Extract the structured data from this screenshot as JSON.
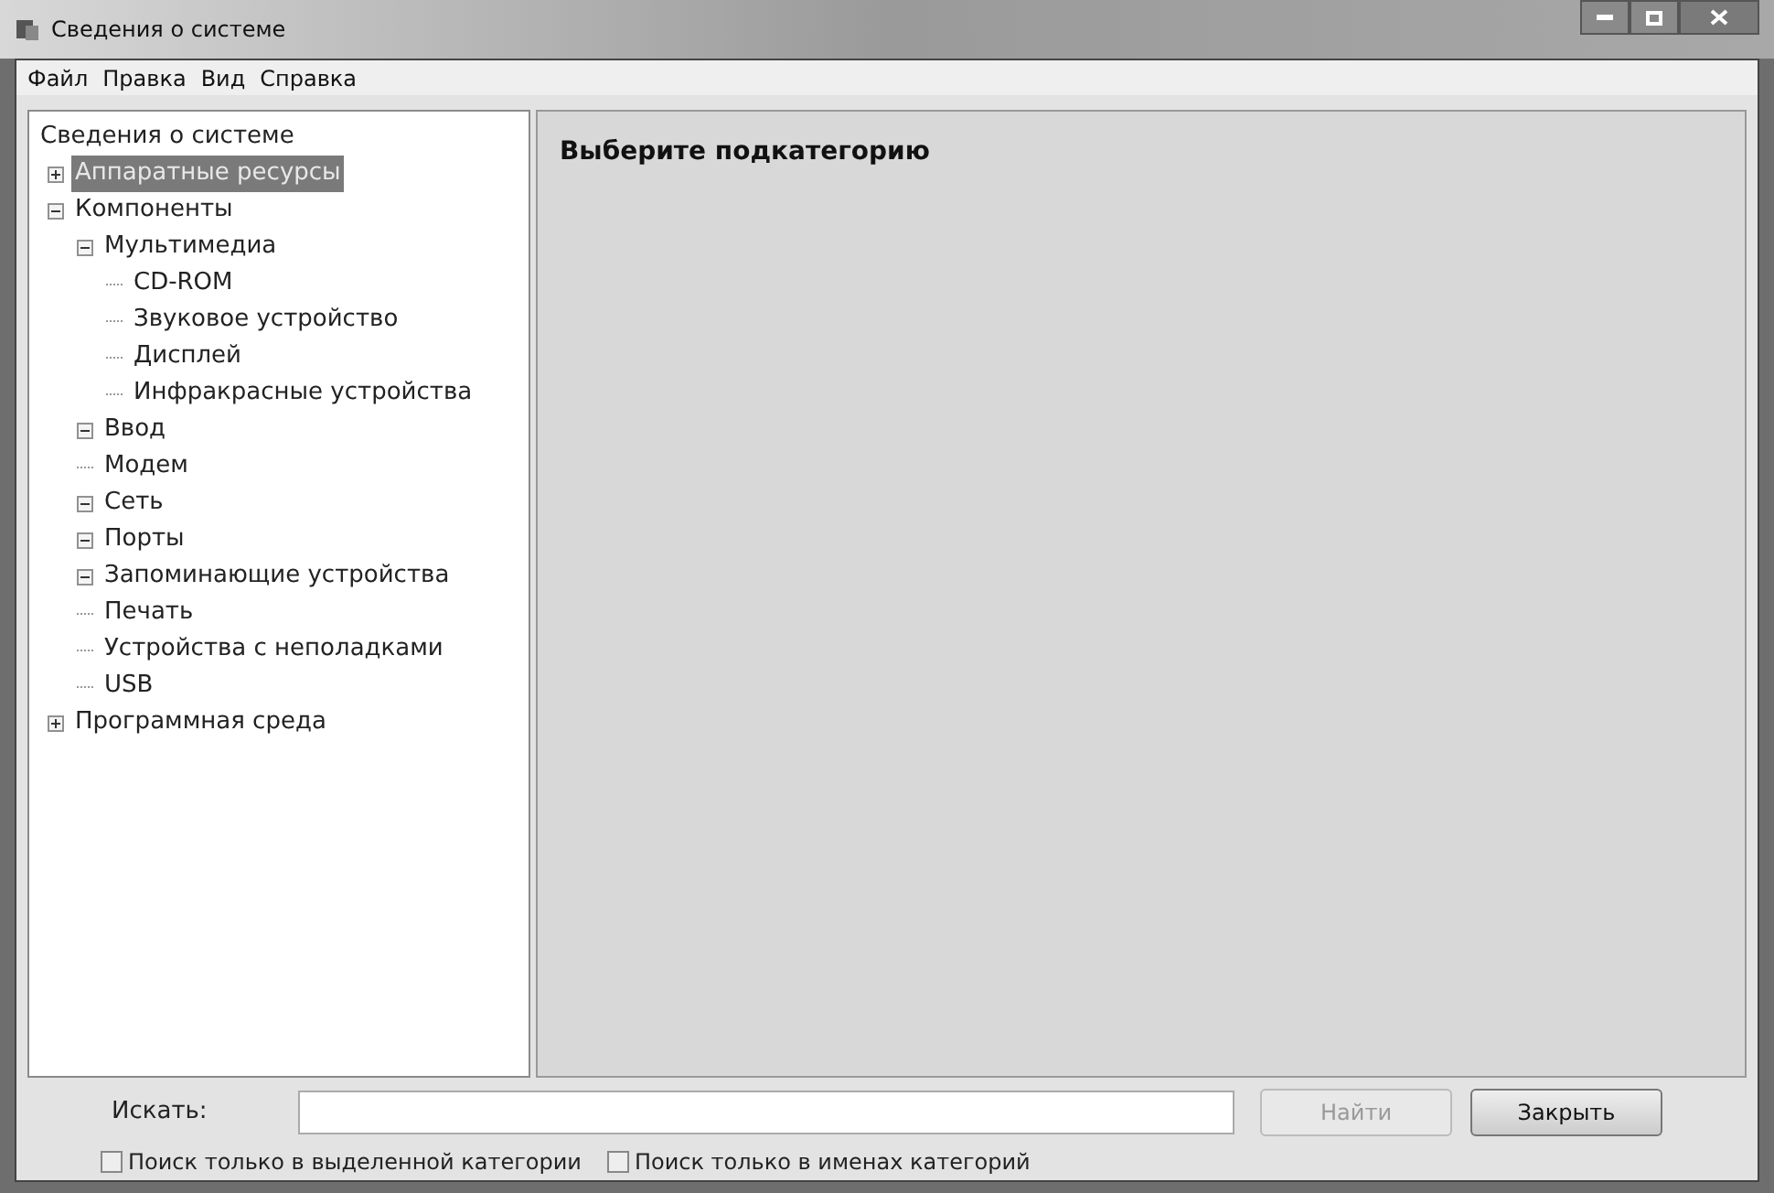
{
  "window": {
    "title": "Сведения о системе"
  },
  "menu": [
    "Файл",
    "Правка",
    "Вид",
    "Справка"
  ],
  "tree": {
    "label": "Сведения о системе",
    "selected": false,
    "children": [
      {
        "label": "Аппаратные ресурсы",
        "selected": true,
        "expanded": false
      },
      {
        "label": "Компоненты",
        "selected": false,
        "expanded": true,
        "children": [
          {
            "label": "Мультимедиа",
            "selected": false,
            "expanded": true,
            "children": [
              {
                "label": "CD-ROM",
                "selected": false
              },
              {
                "label": "Звуковое устройство",
                "selected": false
              },
              {
                "label": "Дисплей",
                "selected": false
              },
              {
                "label": "Инфракрасные устройства",
                "selected": false
              }
            ]
          },
          {
            "label": "Ввод",
            "selected": false,
            "expanded": true
          },
          {
            "label": "Модем",
            "selected": false
          },
          {
            "label": "Сеть",
            "selected": false,
            "expanded": true
          },
          {
            "label": "Порты",
            "selected": false,
            "expanded": true
          },
          {
            "label": "Запоминающие устройства",
            "selected": false,
            "expanded": true
          },
          {
            "label": "Печать",
            "selected": false
          },
          {
            "label": "Устройства с неполадками",
            "selected": false
          },
          {
            "label": "USB",
            "selected": false
          }
        ]
      },
      {
        "label": "Программная среда",
        "selected": false,
        "expanded": false
      }
    ]
  },
  "detail": {
    "heading": "Выберите подкатегорию"
  },
  "search": {
    "label": "Искать:",
    "find_button": {
      "label": "Найти",
      "disabled": true
    },
    "close_button": {
      "label": "Закрыть",
      "disabled": false
    },
    "options": [
      {
        "label": "Поиск только в выделенной категории",
        "checked": false
      },
      {
        "label": "Поиск только в именах категорий",
        "checked": false
      }
    ]
  }
}
